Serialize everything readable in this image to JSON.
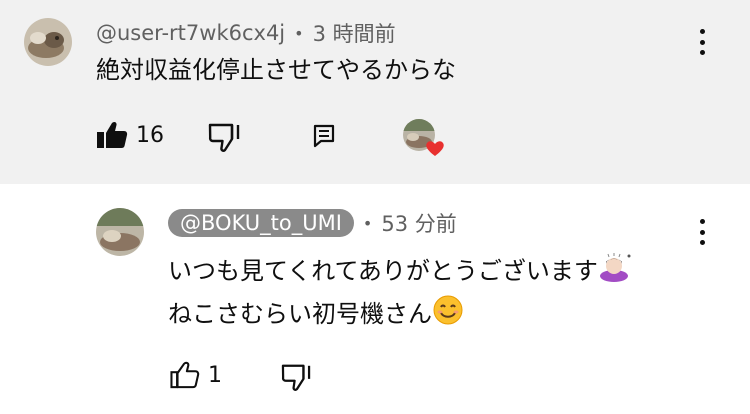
{
  "comment": {
    "handle": "@user-rt7wk6cx4j",
    "separator": "•",
    "time": "3 時間前",
    "text": "絶対収益化停止させてやるからな",
    "like_count": "16",
    "icons": [
      "like-filled-icon",
      "dislike-icon",
      "reply-icon",
      "kebab-menu-icon",
      "creator-heart-icon"
    ]
  },
  "reply": {
    "handle": "@BOKU_to_UMI",
    "separator": "•",
    "time": "53 分前",
    "line1": "いつも見てくれてありがとうございます",
    "line2": "ねこさむらい初号機さん",
    "like_count": "1",
    "icons": [
      "like-outline-icon",
      "dislike-icon",
      "kebab-menu-icon",
      "person-bowing-emoji",
      "smiling-face-emoji"
    ]
  },
  "colors": {
    "comment_bg": "#f1f1f1",
    "reply_bg": "#ffffff",
    "handle_pill": "#8a8a8a",
    "heart": "#e8302f",
    "meta_text": "#606060"
  }
}
